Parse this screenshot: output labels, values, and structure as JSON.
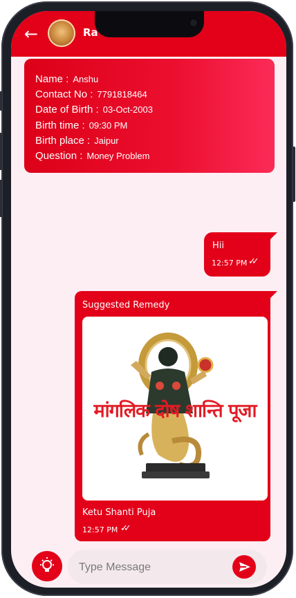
{
  "header": {
    "back_icon": "arrow-left-icon",
    "chat_name": "Ra",
    "color": "#e30019"
  },
  "details": {
    "rows": [
      {
        "label": "Name :",
        "value": "Anshu"
      },
      {
        "label": "Contact No :",
        "value": "7791818464"
      },
      {
        "label": "Date of Birth :",
        "value": "03-Oct-2003"
      },
      {
        "label": "Birth time :",
        "value": "09:30 PM"
      },
      {
        "label": "Birth place :",
        "value": "Jaipur"
      },
      {
        "label": "Question :",
        "value": "Money Problem"
      }
    ]
  },
  "messages": {
    "sent": {
      "text": "Hii",
      "time": "12:57 PM",
      "status_icon": "double-check-icon"
    },
    "remedy": {
      "title": "Suggested Remedy",
      "image_text": "मांगलिक दोष शान्ति पूजा",
      "name": "Ketu Shanti Puja",
      "time": "12:57 PM",
      "status_icon": "double-check-icon"
    }
  },
  "composer": {
    "placeholder": "Type Message",
    "bulb_icon": "lightbulb-icon",
    "send_icon": "send-icon"
  }
}
